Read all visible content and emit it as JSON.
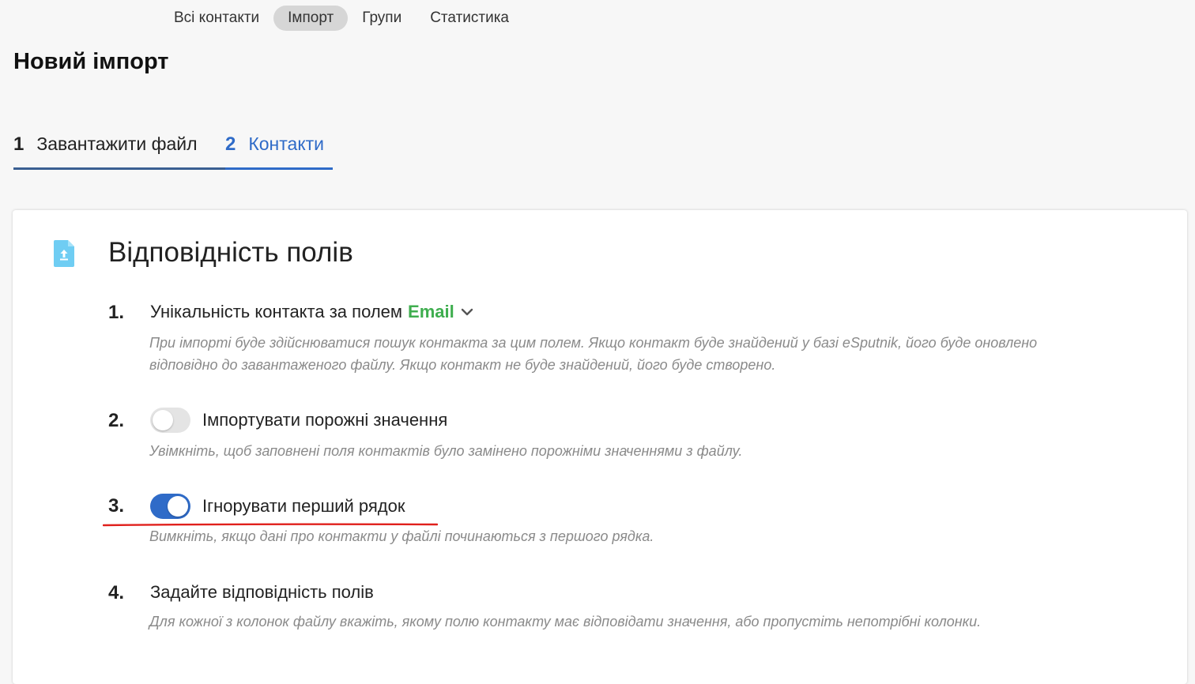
{
  "nav": {
    "items": [
      {
        "label": "Всі контакти",
        "active": false
      },
      {
        "label": "Імпорт",
        "active": true
      },
      {
        "label": "Групи",
        "active": false
      },
      {
        "label": "Статистика",
        "active": false
      }
    ]
  },
  "page_title": "Новий імпорт",
  "steps": [
    {
      "number": "1",
      "label": "Завантажити файл",
      "active": false
    },
    {
      "number": "2",
      "label": "Контакти",
      "active": true
    }
  ],
  "card": {
    "icon": "file-upload-icon",
    "title": "Відповідність полів",
    "items": [
      {
        "number": "1.",
        "label": "Унікальність контакта за полем",
        "field_value": "Email",
        "dropdown_icon": "chevron-down-icon",
        "description": "При імпорті буде здійснюватися пошук контакта за цим полем. Якщо контакт буде знайдений у базі eSputnik, його буде оновлено відповідно до завантаженого файлу. Якщо контакт не буде знайдений, його буде створено."
      },
      {
        "number": "2.",
        "label": "Імпортувати порожні значення",
        "toggle_on": false,
        "description": "Увімкніть, щоб заповнені поля контактів було замінено порожніми значеннями з файлу."
      },
      {
        "number": "3.",
        "label": "Ігнорувати перший рядок",
        "toggle_on": true,
        "description": "Вимкніть, якщо дані про контакти у файлі починаються з першого рядка."
      },
      {
        "number": "4.",
        "label": "Задайте відповідність полів",
        "description": "Для кожної з колонок файлу вкажіть, якому полю контакту має відповідати значення, або пропустіть непотрібні колонки."
      }
    ]
  },
  "colors": {
    "accent_blue": "#2f6bc8",
    "email_green": "#3fae4f",
    "annotation_red": "#e0201c",
    "active_tab_bg": "#d6d6d6"
  }
}
